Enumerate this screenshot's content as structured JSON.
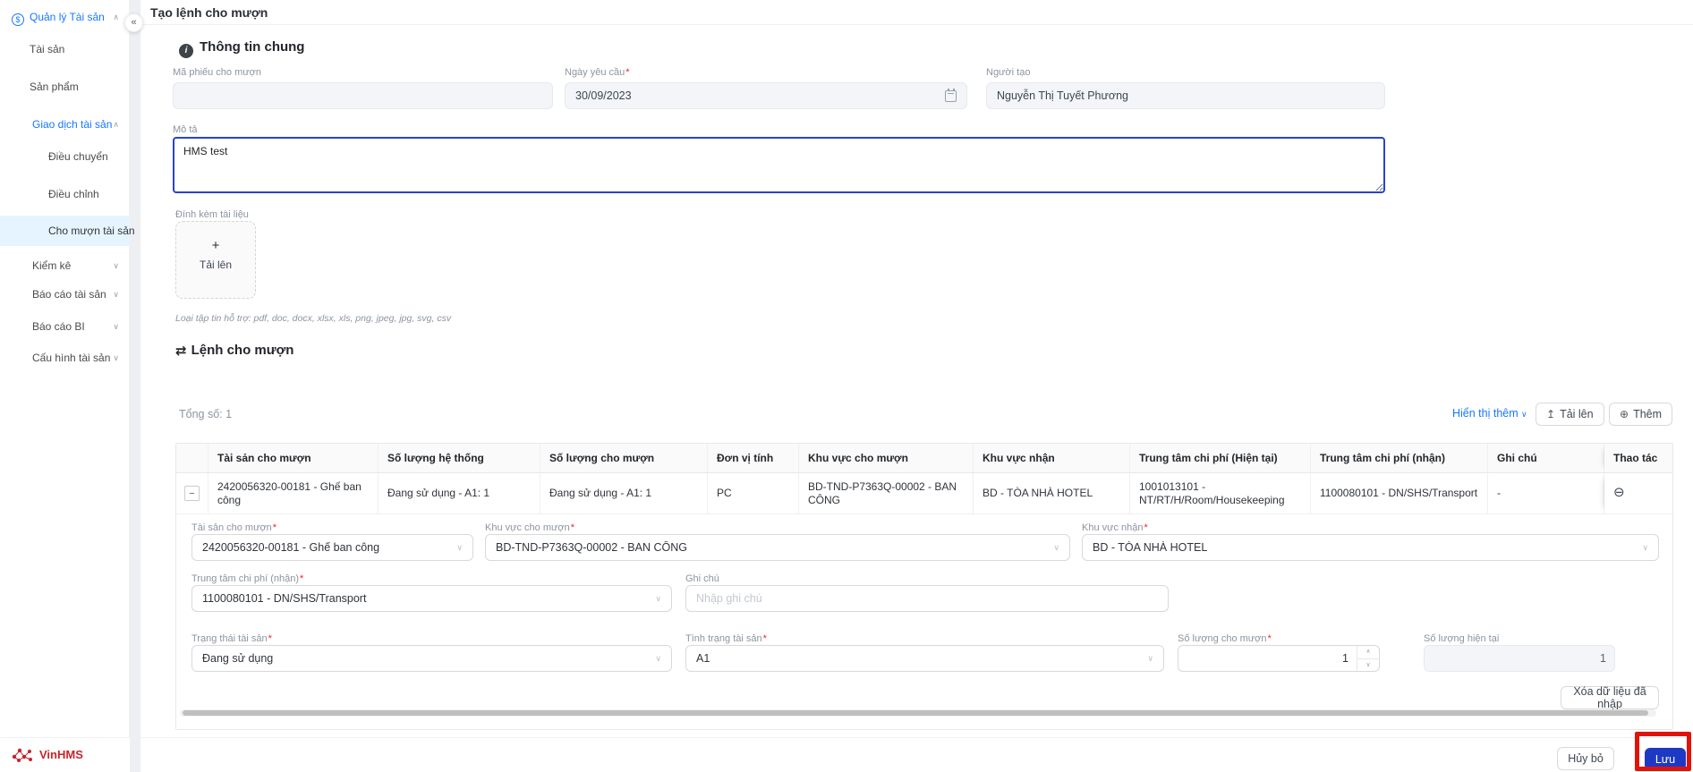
{
  "colors": {
    "link_blue": "#1677ff",
    "primary_blue": "#1d39c4",
    "sidebar_active_bg": "#e6f4ff",
    "annotation_red": "#e11309",
    "brand_red": "#c9242b"
  },
  "icons": {
    "collapse_sidebar": "«",
    "chevron_up": "∧",
    "chevron_down": "∨",
    "select_chevron": "∨",
    "info": "i",
    "swap": "⇄",
    "asset": "$",
    "plus": "+",
    "upload": "↥",
    "add_circle": "⊕",
    "remove_circle": "⊖",
    "collapse_row": "−",
    "calendar": "calendar-glyph"
  },
  "header": {
    "title": "Tạo lệnh cho mượn"
  },
  "sidebar": {
    "brand": "VinHMS",
    "items": [
      {
        "label": "Quản lý Tài sản",
        "level": 0,
        "expanded": true,
        "highlight": true
      },
      {
        "label": "Tài sản",
        "level": 1
      },
      {
        "label": "Sản phẩm",
        "level": 1
      },
      {
        "label": "Giao dịch tài sản",
        "level": 1,
        "expanded": true,
        "highlight": true
      },
      {
        "label": "Điều chuyển",
        "level": 2
      },
      {
        "label": "Điều chỉnh",
        "level": 2
      },
      {
        "label": "Cho mượn tài sản",
        "level": 2,
        "active": true
      },
      {
        "label": "Kiểm kê",
        "level": 1,
        "expanded": false
      },
      {
        "label": "Báo cáo tài sản",
        "level": 1,
        "expanded": false
      },
      {
        "label": "Báo cáo BI",
        "level": 1,
        "expanded": false
      },
      {
        "label": "Cấu hình tài sản",
        "level": 1,
        "expanded": false
      }
    ]
  },
  "general": {
    "section_title": "Thông tin chung",
    "ma_phieu": {
      "label": "Mã phiếu cho mượn",
      "value": "",
      "disabled": true
    },
    "ngay_yeu_cau": {
      "label": "Ngày yêu cầu",
      "required": true,
      "value": "30/09/2023"
    },
    "nguoi_tao": {
      "label": "Người tạo",
      "value": "Nguyễn Thị Tuyết Phương"
    },
    "mo_ta": {
      "label": "Mô tả",
      "value": "HMS test"
    },
    "attachment": {
      "label": "Đính kèm tài liệu",
      "upload_label": "Tải lên"
    },
    "file_note": "Loại tập tin hỗ trợ: pdf, doc, docx, xlsx, xls, png, jpeg, jpg, svg, csv"
  },
  "loan": {
    "section_title": "Lệnh cho mượn",
    "total_label": "Tổng số: 1",
    "show_more_label": "Hiển thị thêm",
    "upload_label": "Tải lên",
    "add_label": "Thêm",
    "table": {
      "headers": [
        "Tài sản cho mượn",
        "Số lượng hệ thống",
        "Số lượng cho mượn",
        "Đơn vị tính",
        "Khu vực cho mượn",
        "Khu vực nhận",
        "Trung tâm chi phí (Hiện tại)",
        "Trung tâm chi phí (nhận)",
        "Ghi chú",
        "Thao tác"
      ],
      "row": {
        "tai_san": "2420056320-00181 - Ghế ban công",
        "sl_he_thong": "Đang sử dụng - A1: 1",
        "sl_cho_muon": "Đang sử dụng - A1: 1",
        "don_vi_tinh": "PC",
        "khu_vuc_cho_muon": "BD-TND-P7363Q-00002 - BAN CÔNG",
        "khu_vuc_nhan": "BD - TÒA NHÀ HOTEL",
        "ttcp_hien_tai": "1001013101 - NT/RT/H/Room/Housekeeping",
        "ttcp_nhan": "1100080101 - DN/SHS/Transport",
        "ghi_chu": "-"
      }
    },
    "detail": {
      "tai_san": {
        "label": "Tài sản cho mượn",
        "required": true,
        "value": "2420056320-00181 - Ghế ban công"
      },
      "khu_vuc_cho_muon": {
        "label": "Khu vực cho mượn",
        "required": true,
        "value": "BD-TND-P7363Q-00002 - BAN CÔNG"
      },
      "khu_vuc_nhan": {
        "label": "Khu vực nhận",
        "required": true,
        "value": "BD - TÒA NHÀ HOTEL"
      },
      "ttcp_nhan": {
        "label": "Trung tâm chi phí (nhận)",
        "required": true,
        "value": "1100080101 - DN/SHS/Transport"
      },
      "ghi_chu": {
        "label": "Ghi chú",
        "placeholder": "Nhập ghi chú",
        "value": ""
      },
      "trang_thai": {
        "label": "Trạng thái tài sản",
        "required": true,
        "value": "Đang sử dụng"
      },
      "tinh_trang": {
        "label": "Tình trạng tài sản",
        "required": true,
        "value": "A1"
      },
      "sl_cho_muon": {
        "label": "Số lượng cho mượn",
        "required": true,
        "value": "1"
      },
      "sl_hien_tai": {
        "label": "Số lượng hiện tại",
        "value": "1",
        "disabled": true
      },
      "clear_label": "Xóa dữ liệu đã nhập"
    }
  },
  "footer": {
    "cancel_label": "Hủy bỏ",
    "save_label": "Lưu"
  }
}
